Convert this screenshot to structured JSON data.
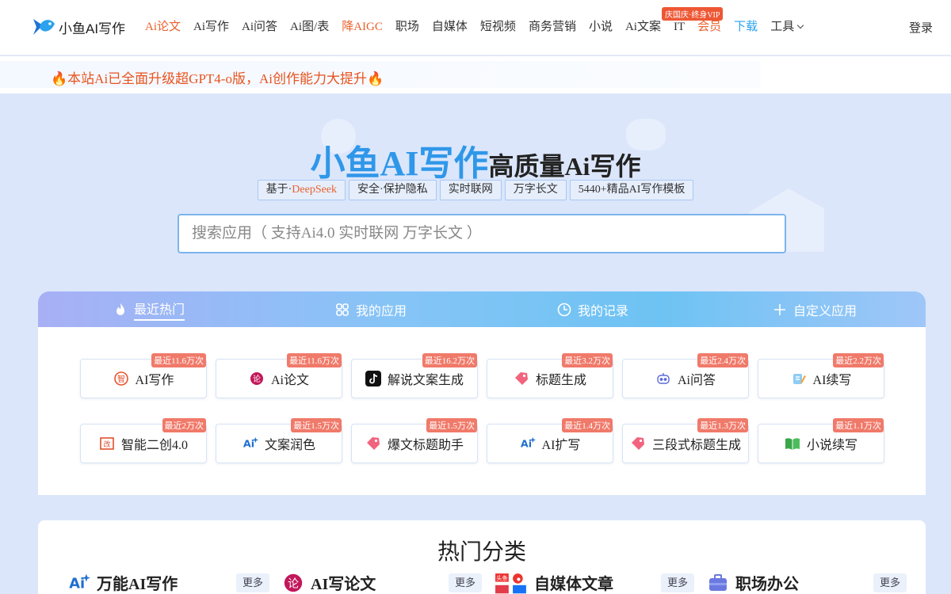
{
  "header": {
    "logo_text": "小鱼AI写作",
    "nav": [
      {
        "label": "Ai论文",
        "style": "active"
      },
      {
        "label": "Ai写作",
        "style": ""
      },
      {
        "label": "Ai问答",
        "style": ""
      },
      {
        "label": "Ai图/表",
        "style": ""
      },
      {
        "label": "降AIGC",
        "style": "red"
      },
      {
        "label": "职场",
        "style": ""
      },
      {
        "label": "自媒体",
        "style": ""
      },
      {
        "label": "短视频",
        "style": ""
      },
      {
        "label": "商务营销",
        "style": ""
      },
      {
        "label": "小说",
        "style": ""
      },
      {
        "label": "Ai文案",
        "style": ""
      },
      {
        "label": "IT",
        "style": ""
      },
      {
        "label": "会员",
        "style": "red"
      },
      {
        "label": "下载",
        "style": "blue"
      },
      {
        "label": "工具",
        "style": "dropdown"
      }
    ],
    "badge": "庆国庆·终身VIP",
    "login": "登录"
  },
  "announcement": "🔥本站Ai已全面升级超GPT4-o版，Ai创作能力大提升🔥",
  "hero": {
    "brand": "小鱼AI写作",
    "subtitle": "高质量Ai写作",
    "pills": [
      {
        "prefix": "基于·",
        "accent": "DeepSeek"
      },
      {
        "prefix": "安全·保护隐私",
        "accent": ""
      },
      {
        "prefix": "实时联网",
        "accent": ""
      },
      {
        "prefix": "万字长文",
        "accent": ""
      },
      {
        "prefix": "5440+精品AI写作模板",
        "accent": ""
      }
    ],
    "search_placeholder": "搜索应用（ 支持Ai4.0 实时联网 万字长文 ）"
  },
  "tabs": [
    {
      "label": "最近热门",
      "icon": "flame-icon"
    },
    {
      "label": "我的应用",
      "icon": "grid-icon"
    },
    {
      "label": "我的记录",
      "icon": "clock-icon"
    },
    {
      "label": "自定义应用",
      "icon": "plus-icon"
    }
  ],
  "apps": [
    {
      "name": "AI写作",
      "badge": "最近11.6万次",
      "icon": "ai-write-icon"
    },
    {
      "name": "Ai论文",
      "badge": "最近11.6万次",
      "icon": "paper-icon"
    },
    {
      "name": "解说文案生成",
      "badge": "最近16.2万次",
      "icon": "tiktok-icon"
    },
    {
      "name": "标题生成",
      "badge": "最近3.2万次",
      "icon": "tag-icon"
    },
    {
      "name": "Ai问答",
      "badge": "最近2.4万次",
      "icon": "chat-bot-icon"
    },
    {
      "name": "AI续写",
      "badge": "最近2.2万次",
      "icon": "pencil-note-icon"
    },
    {
      "name": "智能二创4.0",
      "badge": "最近2万次",
      "icon": "rewrite-icon"
    },
    {
      "name": "文案润色",
      "badge": "最近1.5万次",
      "icon": "ai-sparkle-icon"
    },
    {
      "name": "爆文标题助手",
      "badge": "最近1.5万次",
      "icon": "tag-icon"
    },
    {
      "name": "AI扩写",
      "badge": "最近1.4万次",
      "icon": "ai-sparkle-icon"
    },
    {
      "name": "三段式标题生成",
      "badge": "最近1.3万次",
      "icon": "tag-icon"
    },
    {
      "name": "小说续写",
      "badge": "最近1.1万次",
      "icon": "book-icon"
    }
  ],
  "categories": {
    "title": "热门分类",
    "more_label": "更多",
    "items": [
      {
        "name": "万能AI写作",
        "icon": "ai-sparkle-icon"
      },
      {
        "name": "AI写论文",
        "icon": "paper-icon"
      },
      {
        "name": "自媒体文章",
        "icon": "media-logos-icon"
      },
      {
        "name": "职场办公",
        "icon": "briefcase-icon"
      }
    ]
  },
  "colors": {
    "accent_orange": "#e9622f",
    "brand_blue": "#2f97e9",
    "badge_red": "#f07a6a"
  }
}
